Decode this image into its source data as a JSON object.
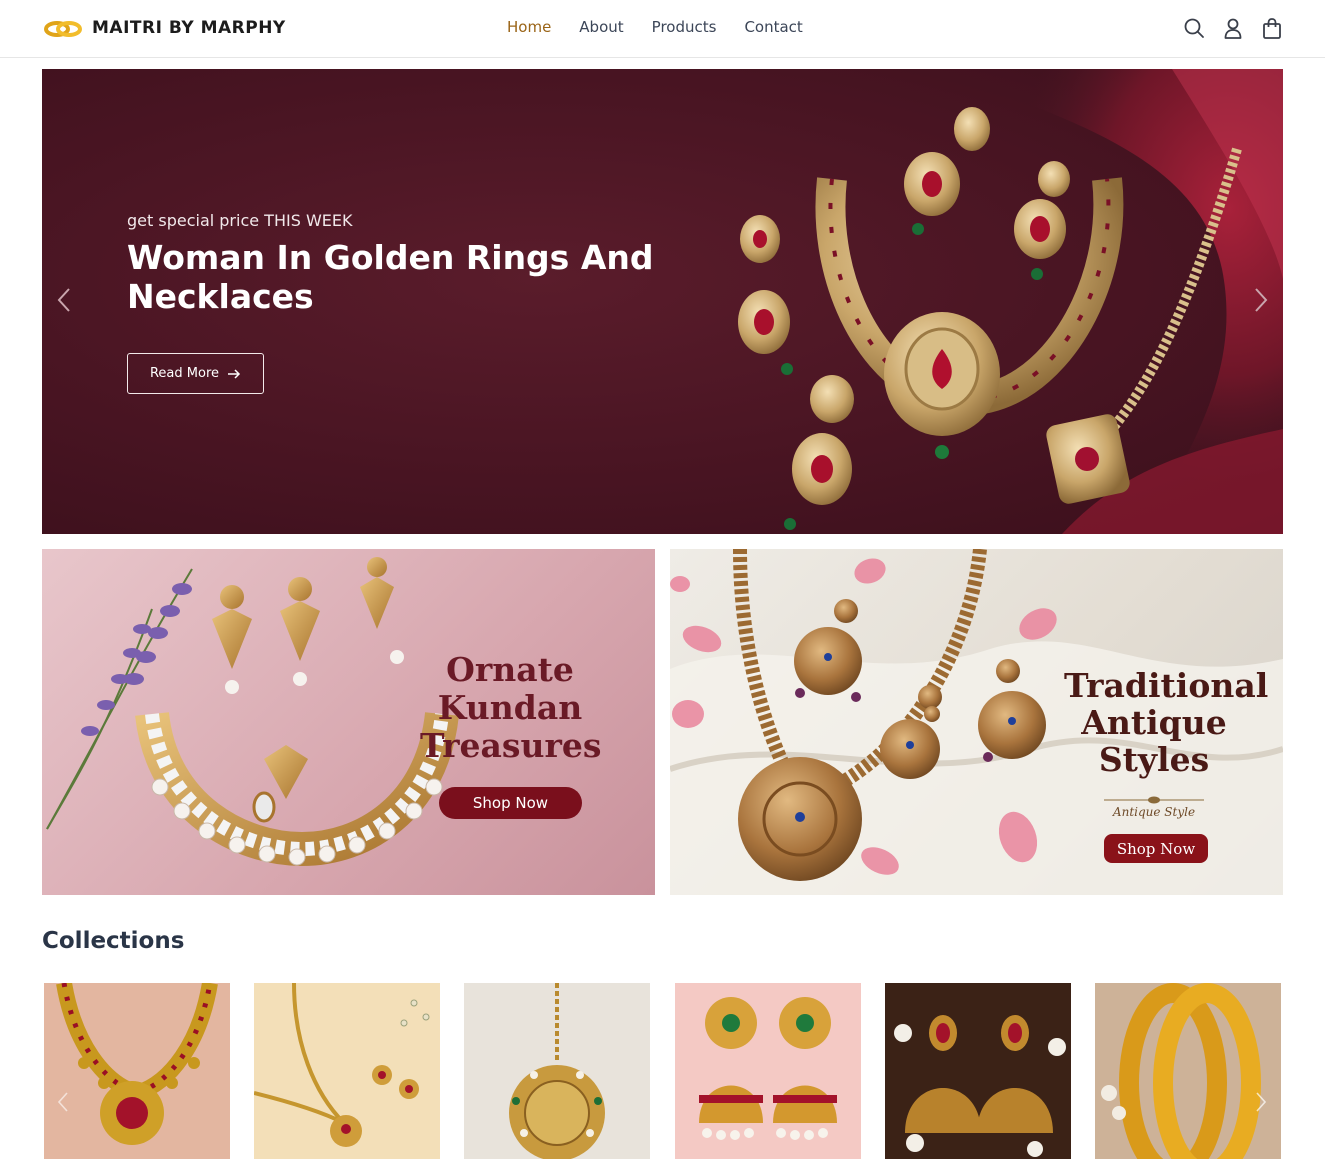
{
  "brand": {
    "name": "MAITRI BY MARPHY",
    "logo_icon": "rings-logo-icon",
    "colors": {
      "accent": "#9a6417",
      "hero_bg": "#4a1523",
      "button_red": "#7a0f1c"
    }
  },
  "nav": {
    "items": [
      {
        "label": "Home",
        "active": true
      },
      {
        "label": "About",
        "active": false
      },
      {
        "label": "Products",
        "active": false
      },
      {
        "label": "Contact",
        "active": false
      }
    ]
  },
  "header_icons": [
    "search-icon",
    "user-icon",
    "shopping-bag-icon"
  ],
  "hero": {
    "eyebrow": "get special price THIS WEEK",
    "title": "Woman In Golden Rings And Necklaces",
    "button_label": "Read More"
  },
  "promos": [
    {
      "title": "Ornate Kundan Treasures",
      "button_label": "Shop Now"
    },
    {
      "title": "Traditional Antique Styles",
      "subtitle": "Antique Style",
      "button_label": "Shop Now"
    }
  ],
  "collections": {
    "title": "Collections",
    "items": [
      {
        "name": "ruby-necklace"
      },
      {
        "name": "gold-chain-set"
      },
      {
        "name": "maang-tikka"
      },
      {
        "name": "jhumka-pearl"
      },
      {
        "name": "jhumka-ruby"
      },
      {
        "name": "gold-bangles"
      }
    ]
  }
}
